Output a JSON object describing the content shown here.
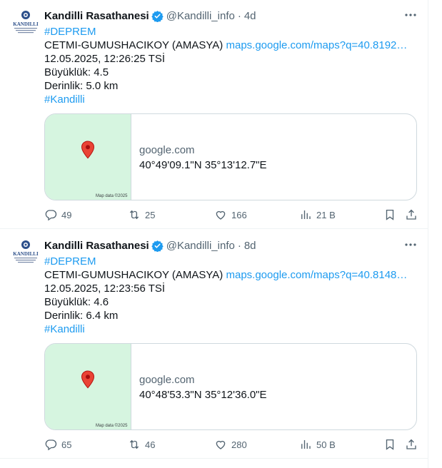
{
  "tweets": [
    {
      "name": "Kandilli Rasathanesi",
      "handle": "@Kandilli_info",
      "separator": "·",
      "time": "4d",
      "hashtag": "#DEPREM",
      "location": "CETMI-GUMUSHACIKOY (AMASYA)",
      "map_link": "maps.google.com/maps?q=40.8192…",
      "datetime": "12.05.2025, 12:26:25 TSİ",
      "magnitude": "Büyüklük: 4.5",
      "depth": "Derinlik: 5.0 km",
      "tag": "#Kandilli",
      "card": {
        "domain": "google.com",
        "coords": "40°49'09.1\"N 35°13'12.7\"E",
        "map_credit": "Map data ©2025"
      },
      "stats": {
        "replies": "49",
        "reposts": "25",
        "likes": "166",
        "views": "21 B"
      }
    },
    {
      "name": "Kandilli Rasathanesi",
      "handle": "@Kandilli_info",
      "separator": "·",
      "time": "8d",
      "hashtag": "#DEPREM",
      "location": "CETMI-GUMUSHACIKOY (AMASYA)",
      "map_link": "maps.google.com/maps?q=40.8148…",
      "datetime": "12.05.2025, 12:23:56 TSİ",
      "magnitude": "Büyüklük: 4.6",
      "depth": "Derinlik: 6.4 km",
      "tag": "#Kandilli",
      "card": {
        "domain": "google.com",
        "coords": "40°48'53.3\"N 35°12'36.0\"E",
        "map_credit": "Map data ©2025"
      },
      "stats": {
        "replies": "65",
        "reposts": "46",
        "likes": "280",
        "views": "50 B"
      }
    }
  ],
  "colors": {
    "link": "#1d9bf0",
    "verified": "#1d9bf0",
    "muted": "#536471",
    "map_bg": "#d6f5e0",
    "pin": "#ea4335"
  }
}
